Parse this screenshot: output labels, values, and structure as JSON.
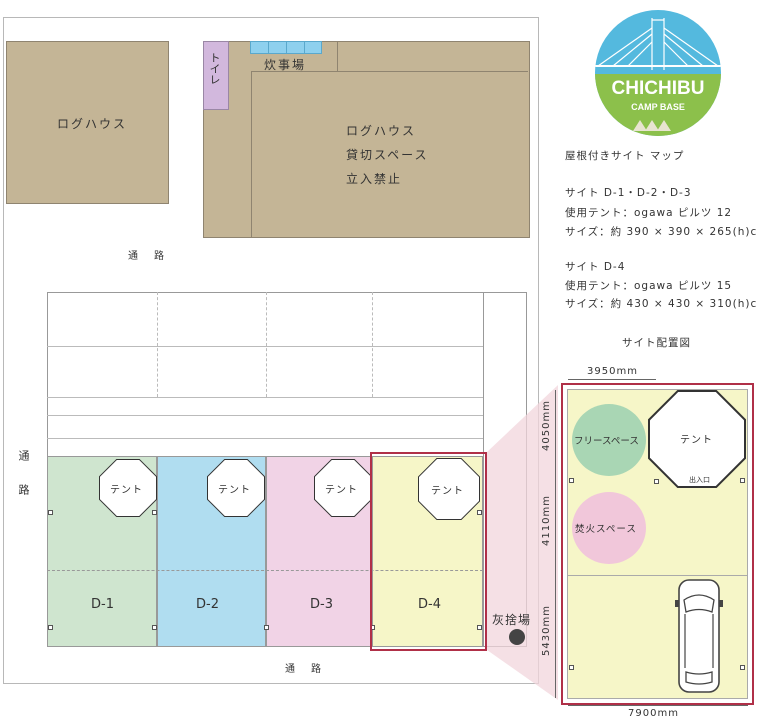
{
  "logo": {
    "name": "CHICHIBU",
    "sub": "CAMP BASE",
    "colors": {
      "sky": "#54b9de",
      "grass": "#8cc04b",
      "tent": "#e8e4d0"
    }
  },
  "buildings": {
    "log_house_left": "ログハウス",
    "log_house_right_lines": [
      "ログハウス",
      "貸切スペース",
      "立入禁止"
    ],
    "toilet": "トイレ",
    "kitchen": "炊事場"
  },
  "roads": {
    "top": "通　路",
    "left": "通　路",
    "bottom": "通　路"
  },
  "sites": [
    {
      "label": "D-1",
      "color": "#cfe5cf",
      "tent": "テント"
    },
    {
      "label": "D-2",
      "color": "#b0ddf0",
      "tent": "テント"
    },
    {
      "label": "D-3",
      "color": "#f1d3e6",
      "tent": "テント"
    },
    {
      "label": "D-4",
      "color": "#f6f6c8",
      "tent": "テント"
    }
  ],
  "ash_dump": "灰捨場",
  "info": {
    "title": "屋根付きサイト マップ",
    "group1": [
      "サイト D-1・D-2・D-3",
      "使用テント：ogawa ピルツ 12",
      "サイズ：約 390 × 390 × 265(h)cm"
    ],
    "group2": [
      "サイト D-4",
      "使用テント：ogawa ピルツ 15",
      "サイズ：約 430 × 430 × 310(h)cm"
    ],
    "layout_title": "サイト配置図"
  },
  "detail": {
    "dim_top": "3950mm",
    "dim_bottom": "7900mm",
    "dim_left": [
      "4050mm",
      "4110mm",
      "5430mm"
    ],
    "free_space": "フリースペース",
    "fire_space": "焚火スペース",
    "tent": "テント",
    "entrance": "出入口"
  },
  "colors": {
    "accent_red": "#b03048",
    "ground": "#c4b596",
    "toilet": "#d2b8dd",
    "kitchen_blue": "#8ed0ee"
  }
}
